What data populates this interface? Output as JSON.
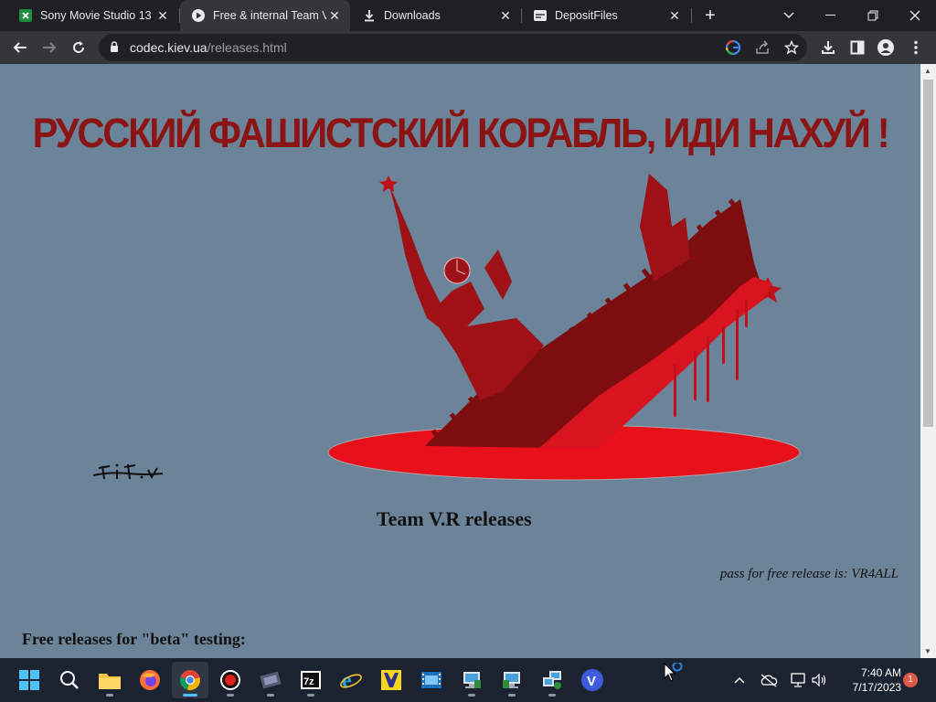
{
  "browser": {
    "tabs": [
      {
        "title": "Sony Movie Studio 13 (",
        "icon": "spreadsheet-green-icon",
        "active": false
      },
      {
        "title": "Free &  internal Team V",
        "icon": "play-circle-icon",
        "active": true
      },
      {
        "title": "Downloads",
        "icon": "download-icon",
        "active": false
      },
      {
        "title": "DepositFiles",
        "icon": "depositfiles-icon",
        "active": false
      }
    ],
    "url_host": "codec.kiev.ua",
    "url_path": "/releases.html"
  },
  "page": {
    "headline": "РУССКИЙ ФАШИСТСКИЙ КОРАБЛЬ, ИДИ НАХУЙ !",
    "signature": "tit.v",
    "section_title": "Team V.R releases",
    "pass_note": "pass for free release is: VR4ALL",
    "free_title": "Free releases for \"beta\" testing:",
    "colors": {
      "background": "#6c8499",
      "headline": "#8b1414",
      "blood": "#e8101a"
    }
  },
  "taskbar": {
    "apps": [
      "start",
      "search",
      "file-explorer",
      "firefox",
      "chrome",
      "recorder",
      "video-editor",
      "7zip",
      "internet-explorer",
      "media-app",
      "film-app",
      "network-tool-1",
      "network-tool-2",
      "network-tool-3",
      "v-app"
    ],
    "time": "7:40 AM",
    "date": "7/17/2023",
    "notifications": "1"
  }
}
